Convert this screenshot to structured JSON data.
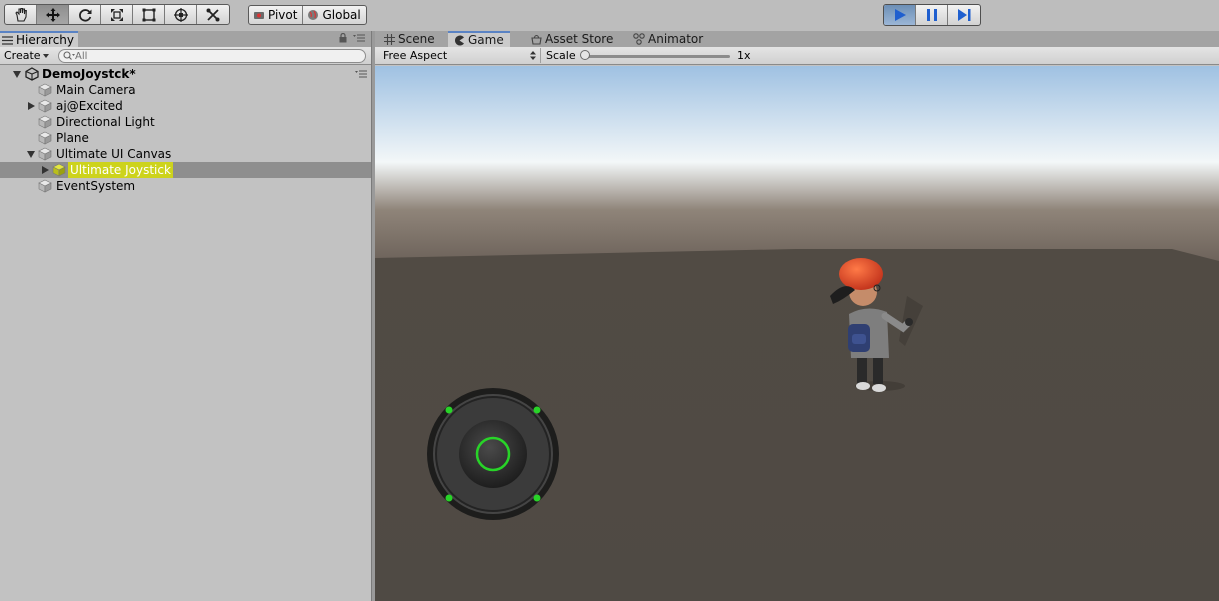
{
  "toolbar": {
    "tools": [
      {
        "icon": "hand-icon",
        "active": false
      },
      {
        "icon": "move-icon",
        "active": true
      },
      {
        "icon": "rotate-icon",
        "active": false
      },
      {
        "icon": "scale-icon",
        "active": false
      },
      {
        "icon": "rect-tool-icon",
        "active": false
      },
      {
        "icon": "transform-icon",
        "active": false
      },
      {
        "icon": "custom-tool-icon",
        "active": false
      }
    ],
    "pivot_label": "Pivot",
    "global_label": "Global",
    "play_state": "playing",
    "play_color": "#2f6fd6"
  },
  "hierarchy": {
    "tab_label": "Hierarchy",
    "create_label": "Create",
    "search_placeholder": "All",
    "scene_name": "DemoJoystck*",
    "items": [
      {
        "label": "Main Camera",
        "depth": 1,
        "expander": "none",
        "selected": false
      },
      {
        "label": "aj@Excited",
        "depth": 1,
        "expander": "collapsed",
        "selected": false
      },
      {
        "label": "Directional Light",
        "depth": 1,
        "expander": "none",
        "selected": false
      },
      {
        "label": "Plane",
        "depth": 1,
        "expander": "none",
        "selected": false
      },
      {
        "label": "Ultimate UI Canvas",
        "depth": 1,
        "expander": "expanded",
        "selected": false
      },
      {
        "label": "Ultimate Joystick",
        "depth": 2,
        "expander": "collapsed",
        "selected": true
      },
      {
        "label": "EventSystem",
        "depth": 1,
        "expander": "none",
        "selected": false
      }
    ],
    "selection_color": "#cdd31c"
  },
  "game_view": {
    "tabs": [
      {
        "label": "Scene",
        "icon": "grid-icon",
        "active": false
      },
      {
        "label": "Game",
        "icon": "pacman-icon",
        "active": true
      },
      {
        "label": "Asset Store",
        "icon": "store-icon",
        "active": false
      },
      {
        "label": "Animator",
        "icon": "animator-icon",
        "active": false
      }
    ],
    "aspect_label": "Free Aspect",
    "scale_label": "Scale",
    "scale_value": "1x",
    "scale_fraction": 0.0,
    "joystick_accent": "#28d428"
  }
}
